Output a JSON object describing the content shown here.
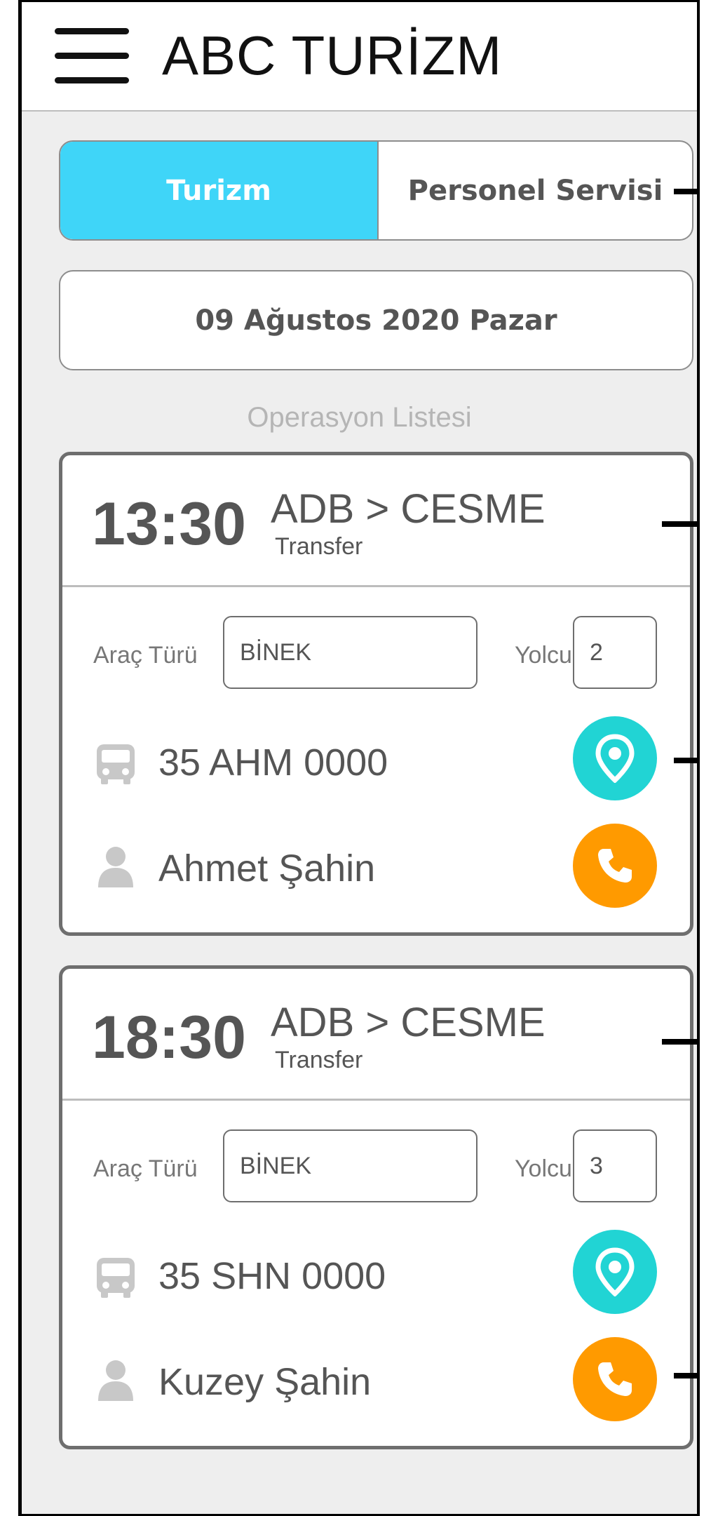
{
  "header": {
    "title": "ABC TURİZM"
  },
  "tabs": [
    {
      "label": "Turizm",
      "active": true
    },
    {
      "label": "Personel Servisi",
      "active": false
    }
  ],
  "date": "09 Ağustos 2020 Pazar",
  "list_title": "Operasyon Listesi",
  "labels": {
    "vehicle_type": "Araç Türü",
    "passenger": "Yolcu"
  },
  "operations": [
    {
      "time": "13:30",
      "route": "ADB > CESME",
      "type": "Transfer",
      "vehicle_type": "BİNEK",
      "passengers": "2",
      "plate": "35 AHM 0000",
      "driver": "Ahmet Şahin"
    },
    {
      "time": "18:30",
      "route": "ADB > CESME",
      "type": "Transfer",
      "vehicle_type": "BİNEK",
      "passengers": "3",
      "plate": "35 SHN 0000",
      "driver": "Kuzey Şahin"
    }
  ],
  "colors": {
    "active_tab": "#3fd5f8",
    "location_button": "#21d4d4",
    "call_button": "#ff9a00"
  },
  "icons": [
    "menu-icon",
    "bus-icon",
    "user-icon",
    "location-pin-icon",
    "phone-icon"
  ]
}
